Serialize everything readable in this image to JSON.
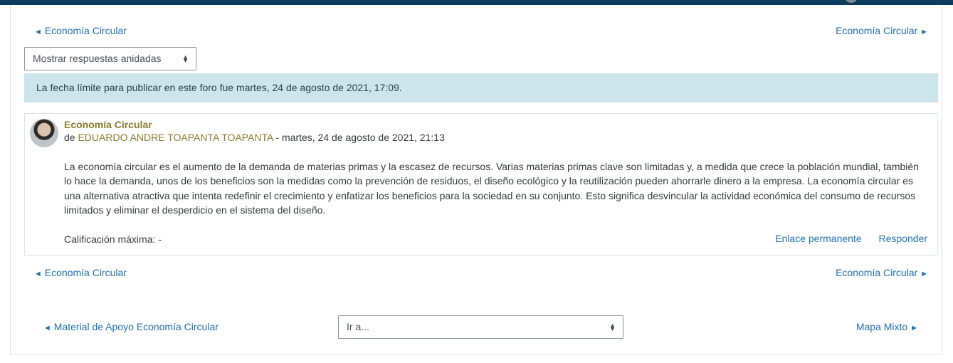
{
  "colors": {
    "topbar": "#0d3b5e",
    "link": "#1f6fae",
    "author": "#8c7b2e",
    "alert_bg": "#cce5ea"
  },
  "discussion_nav_top": {
    "prev": {
      "arrow": "◄",
      "label": "Economía Circular"
    },
    "next": {
      "arrow": "►",
      "label": "Economía Circular"
    }
  },
  "display_mode": {
    "selected": "Mostrar respuestas anidadas",
    "icon": "updown-caret-icon"
  },
  "alert": {
    "text": "La fecha límite para publicar en este foro fue martes, 24 de agosto de 2021, 17:09."
  },
  "post": {
    "subject": "Economía Circular",
    "by_prefix": "de",
    "author": "EDUARDO ANDRE TOAPANTA TOAPANTA",
    "date_sep": " - martes, 24 de agosto de 2021, 21:13",
    "body": "La economía circular es el aumento de la demanda de materias primas y la escasez de recursos. Varias materias primas clave son limitadas y, a medida que crece la población mundial, también lo hace la demanda, unos de los beneficios son la medidas como la prevención de residuos, el diseño ecológico y la reutilización pueden ahorrarle dinero a la empresa. La economía circular es una alternativa atractiva que intenta redefinir el crecimiento y enfatizar los beneficios para la sociedad en su conjunto. Esto significa desvincular la actividad económica del consumo de recursos limitados y eliminar el desperdicio en el sistema del diseño.",
    "rating": "Calificación máxima: -",
    "permalink": "Enlace permanente",
    "reply": "Responder"
  },
  "discussion_nav_bottom": {
    "prev": {
      "arrow": "◄",
      "label": "Economía Circular"
    },
    "next": {
      "arrow": "►",
      "label": "Economía Circular"
    }
  },
  "activity_nav": {
    "prev": {
      "arrow": "◄",
      "label": "Material de Apoyo Economía Circular"
    },
    "jump": {
      "selected": "Ir a...",
      "icon": "updown-caret-icon"
    },
    "next": {
      "arrow": "►",
      "label": "Mapa Mixto"
    }
  }
}
